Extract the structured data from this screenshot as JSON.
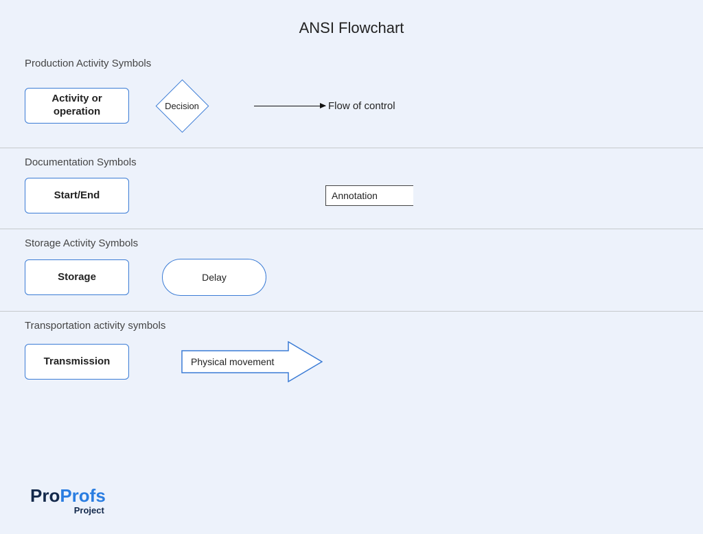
{
  "title": "ANSI Flowchart",
  "sections": {
    "production": {
      "heading": "Production Activity Symbols",
      "activity": "Activity or operation",
      "decision": "Decision",
      "flow": "Flow of control"
    },
    "documentation": {
      "heading": "Documentation Symbols",
      "startend": "Start/End",
      "annotation": "Annotation"
    },
    "storage": {
      "heading": "Storage Activity Symbols",
      "storage": "Storage",
      "delay": "Delay"
    },
    "transport": {
      "heading": "Transportation activity symbols",
      "transmission": "Transmission",
      "movement": "Physical movement"
    }
  },
  "logo": {
    "pro": "Pro",
    "profs": "Profs",
    "sub": "Project"
  }
}
